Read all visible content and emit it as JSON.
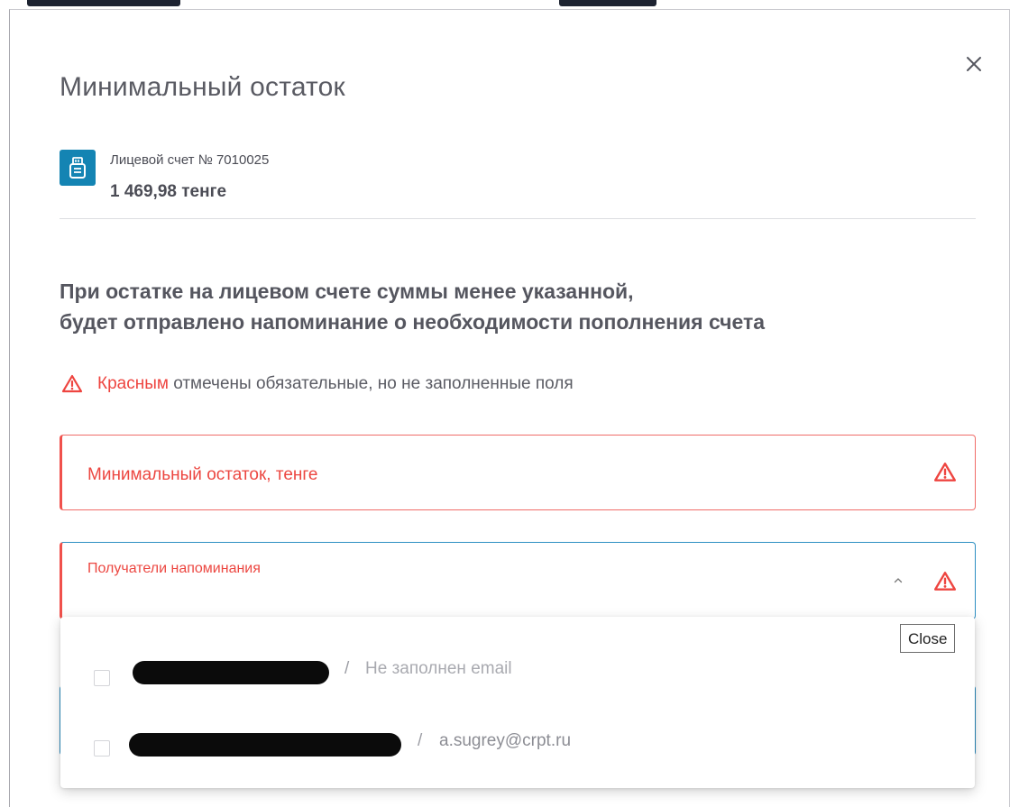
{
  "dialog": {
    "title": "Минимальный остаток",
    "close_icon": "close-icon"
  },
  "account": {
    "icon": "cash-register-icon",
    "label": "Лицевой счет № 7010025",
    "balance": "1 469,98 тенге"
  },
  "description": {
    "line1": "При остатке на лицевом счете суммы менее указанной,",
    "line2": "будет отправлено напоминание о необходимости пополнения счета"
  },
  "required_note": {
    "icon": "warning-icon",
    "highlight": "Красным",
    "rest": "отмечены обязательные, но не заполненные поля"
  },
  "fields": {
    "min_balance": {
      "label": "Минимальный остаток, тенге",
      "value": "",
      "icon": "warning-icon"
    },
    "recipients": {
      "label": "Получатели напоминания",
      "value": "",
      "toggle_icon": "chevron-up-icon",
      "icon": "warning-icon",
      "expanded": true,
      "options": [
        {
          "name_redacted": true,
          "separator": "/",
          "email": "Не заполнен email",
          "checked": false
        },
        {
          "name_redacted": true,
          "separator": "/",
          "email": "a.sugrey@crpt.ru",
          "checked": false
        }
      ]
    }
  },
  "tooltip": {
    "text": "Close"
  },
  "colors": {
    "error": "#ee4540",
    "accent": "#1484b3",
    "focus_border": "#2d8fc2"
  }
}
